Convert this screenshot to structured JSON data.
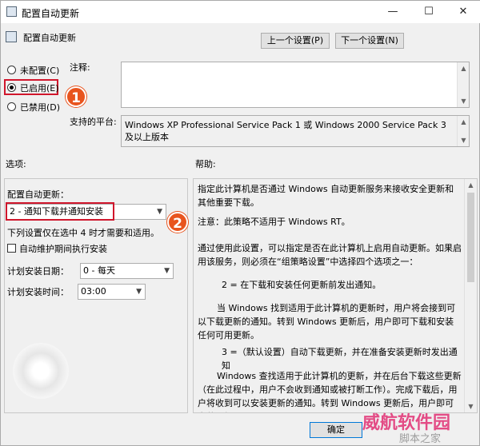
{
  "window": {
    "title": "配置自动更新",
    "minimize_glyph": "—",
    "maximize_glyph": "☐",
    "close_glyph": "✕"
  },
  "header": {
    "policy_name": "配置自动更新",
    "prev_button": "上一个设置(P)",
    "next_button": "下一个设置(N)"
  },
  "state_options": [
    {
      "label": "未配置(C)",
      "selected": false
    },
    {
      "label": "已启用(E)",
      "selected": true
    },
    {
      "label": "已禁用(D)",
      "selected": false
    }
  ],
  "comment_label": "注释:",
  "supported_label": "支持的平台:",
  "supported_value": "Windows XP Professional Service Pack 1 或 Windows 2000 Service Pack 3 及以上版本",
  "options_label": "选项:",
  "help_label": "帮助:",
  "options": {
    "configure_label": "配置自动更新：",
    "configure_value": "2 - 通知下载并通知安装",
    "note": "下列设置仅在选中 4 时才需要和适用。",
    "maintenance_checkbox": "自动维护期间执行安装",
    "day_label": "计划安装日期：",
    "day_value": "0 - 每天",
    "time_label": "计划安装时间：",
    "time_value": "03:00"
  },
  "help_paragraphs": [
    "指定此计算机是否通过 Windows 自动更新服务来接收安全更新和其他重要下载。",
    "注意：此策略不适用于 Windows RT。",
    "通过使用此设置，可以指定是否在此计算机上启用自动更新。如果启用该服务，则必须在“组策略设置”中选择四个选项之一：",
    "2 = 在下载和安装任何更新前发出通知。",
    "当 Windows 找到适用于此计算机的更新时，用户将会接到可以下载更新的通知。转到 Windows 更新后，用户即可下载和安装任何可用更新。",
    "3 =（默认设置）自动下载更新，并在准备安装更新时发出通知",
    "Windows 查找适用于此计算机的更新，并在后台下载这些更新（在此过程中，用户不会收到通知或被打断工作）。完成下载后，用户将收到可以安装更新的通知。转到 Windows 更新后，用户即可安装更新。"
  ],
  "footer": {
    "ok_button": "确定"
  },
  "annotations": {
    "badge1": "1",
    "badge2": "2"
  },
  "watermark": {
    "text1": "威航软件园",
    "text2": "脚本之家"
  },
  "colors": {
    "highlight_red": "#d0162c",
    "badge_orange": "#e8541e"
  }
}
